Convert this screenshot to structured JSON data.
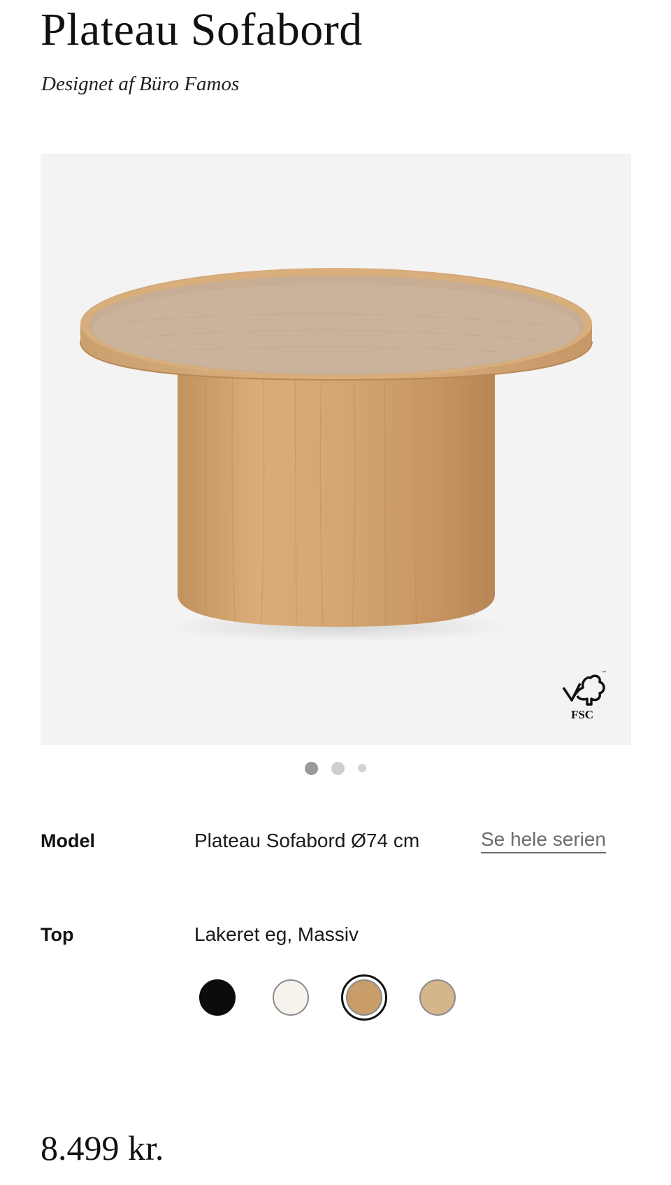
{
  "product": {
    "title": "Plateau Sofabord",
    "designer": "Designet af Büro Famos",
    "price": "8.499 kr."
  },
  "gallery": {
    "image_alt": "Plateau Sofabord",
    "badge_text": "FSC",
    "slide_count": 3,
    "active_slide": 1
  },
  "options": {
    "model": {
      "label": "Model",
      "value": "Plateau Sofabord Ø74 cm",
      "link": "Se hele serien"
    },
    "top": {
      "label": "Top",
      "value": "Lakeret eg, Massiv",
      "swatches": [
        {
          "name": "black",
          "color": "#0c0c0c",
          "selected": false
        },
        {
          "name": "white",
          "color": "#f6f3ec",
          "selected": false
        },
        {
          "name": "lacquered-oak",
          "color": "#c89d6a",
          "selected": true
        },
        {
          "name": "light-oak",
          "color": "#d5b68c",
          "selected": false
        }
      ]
    }
  }
}
